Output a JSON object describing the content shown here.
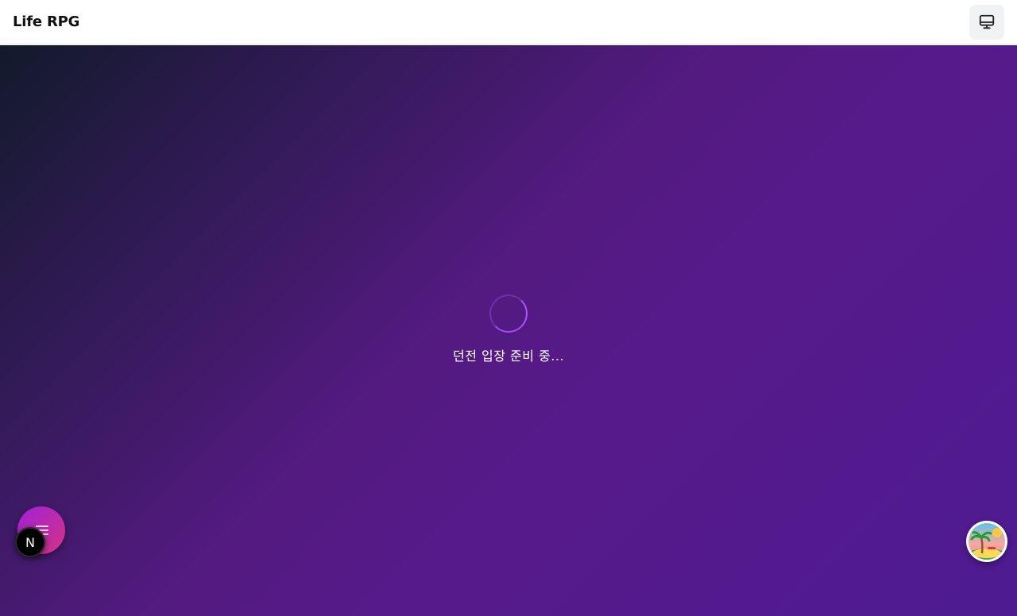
{
  "header": {
    "title": "Life RPG",
    "device_toggle_icon": "monitor-icon"
  },
  "main": {
    "loading_text": "던전 입장 준비 중...",
    "spinner_color": "#a855f7",
    "background_colors": [
      "#121a2a",
      "#531a80",
      "#4e1b91"
    ]
  },
  "floating": {
    "menu_icon": "menu-icon",
    "dev_badge_letter": "N",
    "avatar_icon": "tropical-island-icon"
  }
}
